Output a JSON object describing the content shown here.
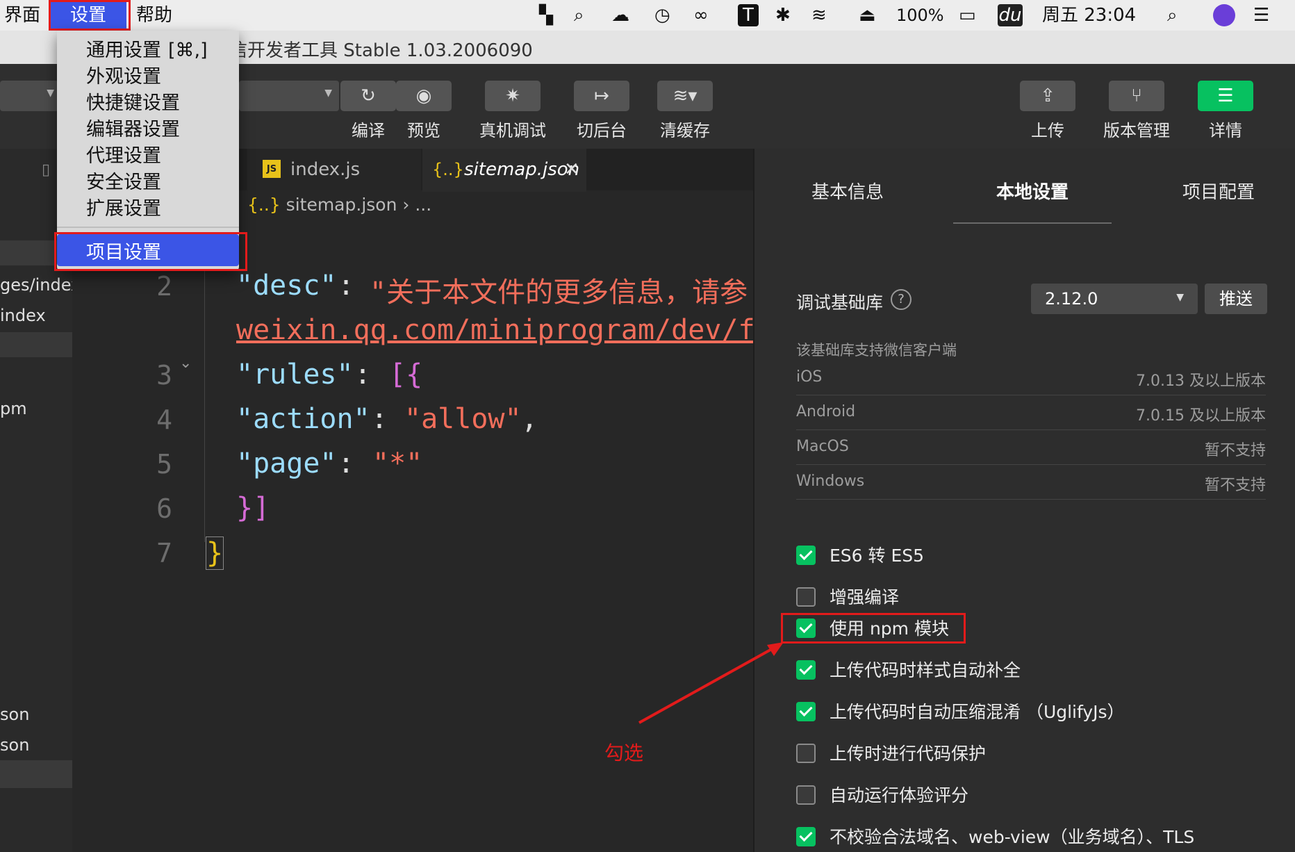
{
  "menubar": {
    "items": [
      "界面",
      "设置",
      "帮助"
    ],
    "status": {
      "battery": "100%",
      "clock": "周五 23:04"
    }
  },
  "window": {
    "title": "信开发者工具 Stable 1.03.2006090"
  },
  "dropdown": {
    "items": [
      "通用设置",
      "外观设置",
      "快捷键设置",
      "编辑器设置",
      "代理设置",
      "安全设置",
      "扩展设置"
    ],
    "shortcut": "[⌘,]",
    "active_item": "项目设置"
  },
  "toolbar": {
    "compile": "编译",
    "preview": "预览",
    "remote_debug": "真机调试",
    "background": "切后台",
    "clear_cache": "清缓存",
    "upload": "上传",
    "version": "版本管理",
    "details": "详情"
  },
  "sidebar": {
    "items": [
      "ges/index",
      "index",
      "pm",
      "son",
      "son"
    ]
  },
  "editor": {
    "tabs": [
      {
        "label": "index.js",
        "icon": "JS"
      },
      {
        "label": "sitemap.json",
        "icon": "{..}"
      }
    ],
    "breadcrumb": "sitemap.json",
    "breadcrumb_more": "...",
    "line_numbers": [
      "2",
      "3",
      "4",
      "5",
      "6",
      "7"
    ],
    "lines": {
      "desc_key": "\"desc\"",
      "desc_val": "\"关于本文件的更多信息，请参",
      "desc_val2": "weixin.qq.com/miniprogram/dev/f",
      "rules_key": "\"rules\"",
      "bracket": "[{",
      "action_key": "\"action\"",
      "action_val": "\"allow\"",
      "page_key": "\"page\"",
      "page_val": "\"*\"",
      "close1": "}]",
      "close2": "}"
    }
  },
  "panel": {
    "tabs": [
      "基本信息",
      "本地设置",
      "项目配置"
    ],
    "debug_lib_label": "调试基础库",
    "debug_lib_value": "2.12.0",
    "push_button": "推送",
    "support_note": "该基础库支持微信客户端",
    "support": [
      {
        "platform": "iOS",
        "value": "7.0.13 及以上版本"
      },
      {
        "platform": "Android",
        "value": "7.0.15 及以上版本"
      },
      {
        "platform": "MacOS",
        "value": "暂不支持"
      },
      {
        "platform": "Windows",
        "value": "暂不支持"
      }
    ],
    "options": [
      {
        "label": "ES6 转 ES5",
        "checked": true
      },
      {
        "label": "增强编译",
        "checked": false
      },
      {
        "label": "使用 npm 模块",
        "checked": true
      },
      {
        "label": "上传代码时样式自动补全",
        "checked": true
      },
      {
        "label": "上传代码时自动压缩混淆 （UglifyJs）",
        "checked": true
      },
      {
        "label": "上传时进行代码保护",
        "checked": false
      },
      {
        "label": "自动运行体验评分",
        "checked": false
      },
      {
        "label": "不校验合法域名、web-view（业务域名）、TLS",
        "checked": true
      }
    ]
  },
  "annotation": {
    "text": "勾选"
  },
  "colors": {
    "accent": "#07c160",
    "highlight": "#3b55e6",
    "annotation": "#e21b1b"
  }
}
